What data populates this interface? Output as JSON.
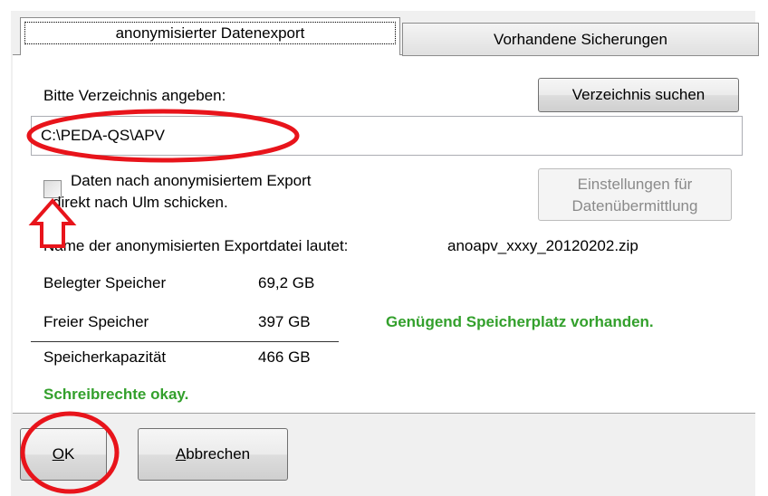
{
  "tabs": {
    "active_label": "anonymisierter Datenexport",
    "inactive_label": "Vorhandene Sicherungen"
  },
  "directory": {
    "prompt_label": "Bitte Verzeichnis angeben:",
    "browse_button": "Verzeichnis suchen",
    "path_value": "C:\\PEDA-QS\\APV"
  },
  "send_option": {
    "checkbox_label_line1": "Daten nach anonymisiertem Export",
    "checkbox_label_line2": "direkt nach Ulm schicken.",
    "checked": false,
    "settings_button_line1": "Einstellungen für",
    "settings_button_line2": "Datenübermittlung"
  },
  "export_file": {
    "label": "Name der anonymisierten Exportdatei lautet:",
    "filename": "anoapv_xxxy_20120202.zip"
  },
  "storage": {
    "used_label": "Belegter Speicher",
    "used_value": "69,2 GB",
    "free_label": "Freier Speicher",
    "free_value": "397 GB",
    "free_status": "Genügend Speicherplatz vorhanden.",
    "capacity_label": "Speicherkapazität",
    "capacity_value": "466 GB"
  },
  "write_status": "Schreibrechte okay.",
  "footer": {
    "ok_mnemonic": "O",
    "ok_rest": "K",
    "cancel_mnemonic": "A",
    "cancel_rest": "bbrechen"
  },
  "colors": {
    "status_green": "#33a02c",
    "annotation_red": "#e8141b"
  }
}
